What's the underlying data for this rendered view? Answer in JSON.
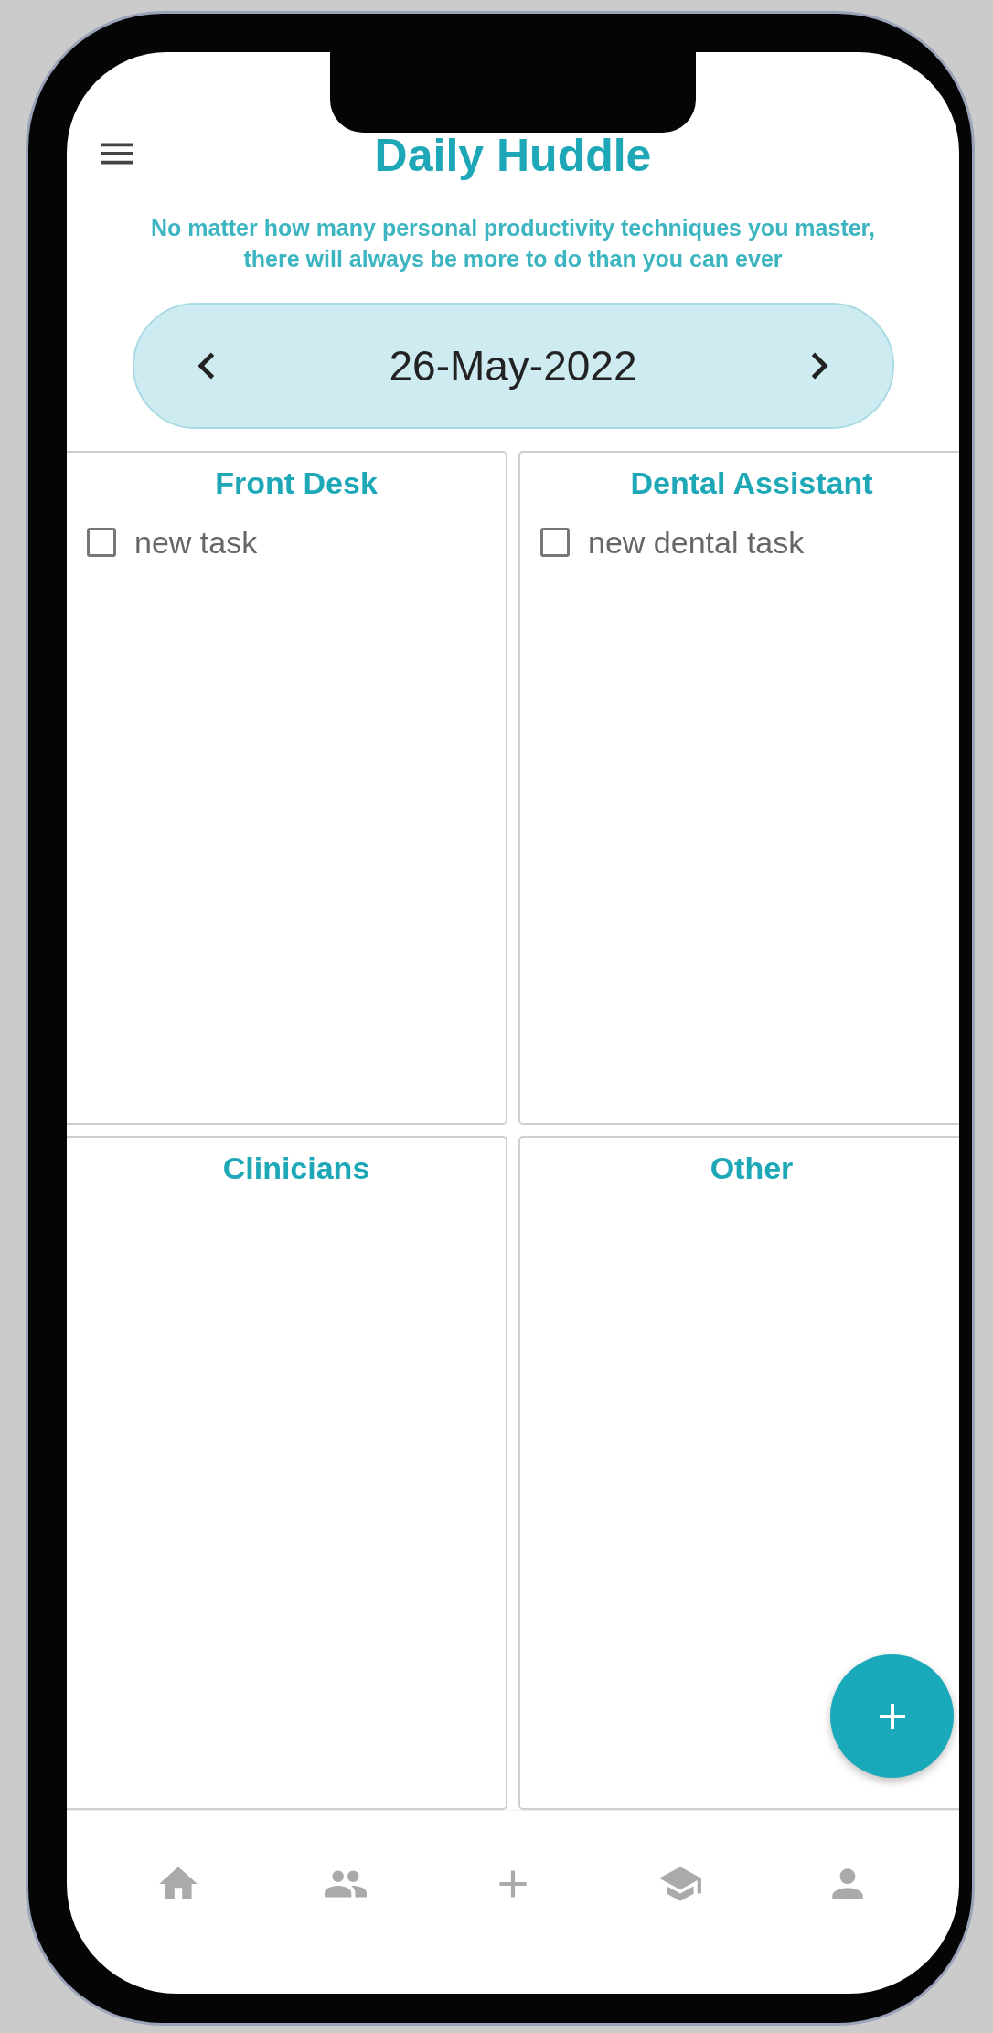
{
  "header": {
    "title": "Daily Huddle",
    "subtitle": "No matter how many personal productivity techniques you master, there will always be more to do than you can ever"
  },
  "date": {
    "value": "26-May-2022"
  },
  "panels": [
    {
      "title": "Front Desk",
      "tasks": [
        {
          "label": "new task",
          "checked": false
        }
      ]
    },
    {
      "title": "Dental Assistant",
      "tasks": [
        {
          "label": "new dental task",
          "checked": false
        }
      ]
    },
    {
      "title": "Clinicians"
    },
    {
      "title": "Other"
    }
  ],
  "bottom_nav": [
    {
      "kind": "home"
    },
    {
      "kind": "people"
    },
    {
      "kind": "add"
    },
    {
      "kind": "school"
    },
    {
      "kind": "person"
    }
  ]
}
